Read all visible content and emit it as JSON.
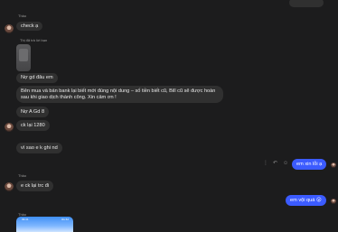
{
  "chat": {
    "top_bubble_text": "",
    "sender_name": "Thảo",
    "msg_check": "check ạ",
    "reply_context": "Thị đã trả lời bạn",
    "msg_no_gd": "Nợ gd đâu em",
    "msg_notice": "Bên mua và bán bank lại biết mới đúng nội dung – số tiền biết cũ, Bill cũ sẽ được hoàn sau khi giao dịch thành công. Xin cảm ơn !",
    "msg_ngd": "Nợ A Gd 8",
    "msg_ck": "ck lại 1280",
    "msg_visao": "vì sao e k ghi nd",
    "msg_me_1": "em xin lỗi ạ",
    "msg_eck": "e ck lại trc đi",
    "msg_me_2": "em vội quá 😮",
    "sender_name_3": "Thảo",
    "sender_name_4": "Thảo",
    "phone_time": "09:41",
    "phone_status": "4G 62"
  },
  "icons": {
    "reply": "reply-icon",
    "react": "emoji-icon",
    "more": "more-icon",
    "seen": "seen-avatar-icon"
  },
  "colors": {
    "background": "#1c1c1d",
    "incoming": "#303030",
    "outgoing": "#3b5bff"
  }
}
